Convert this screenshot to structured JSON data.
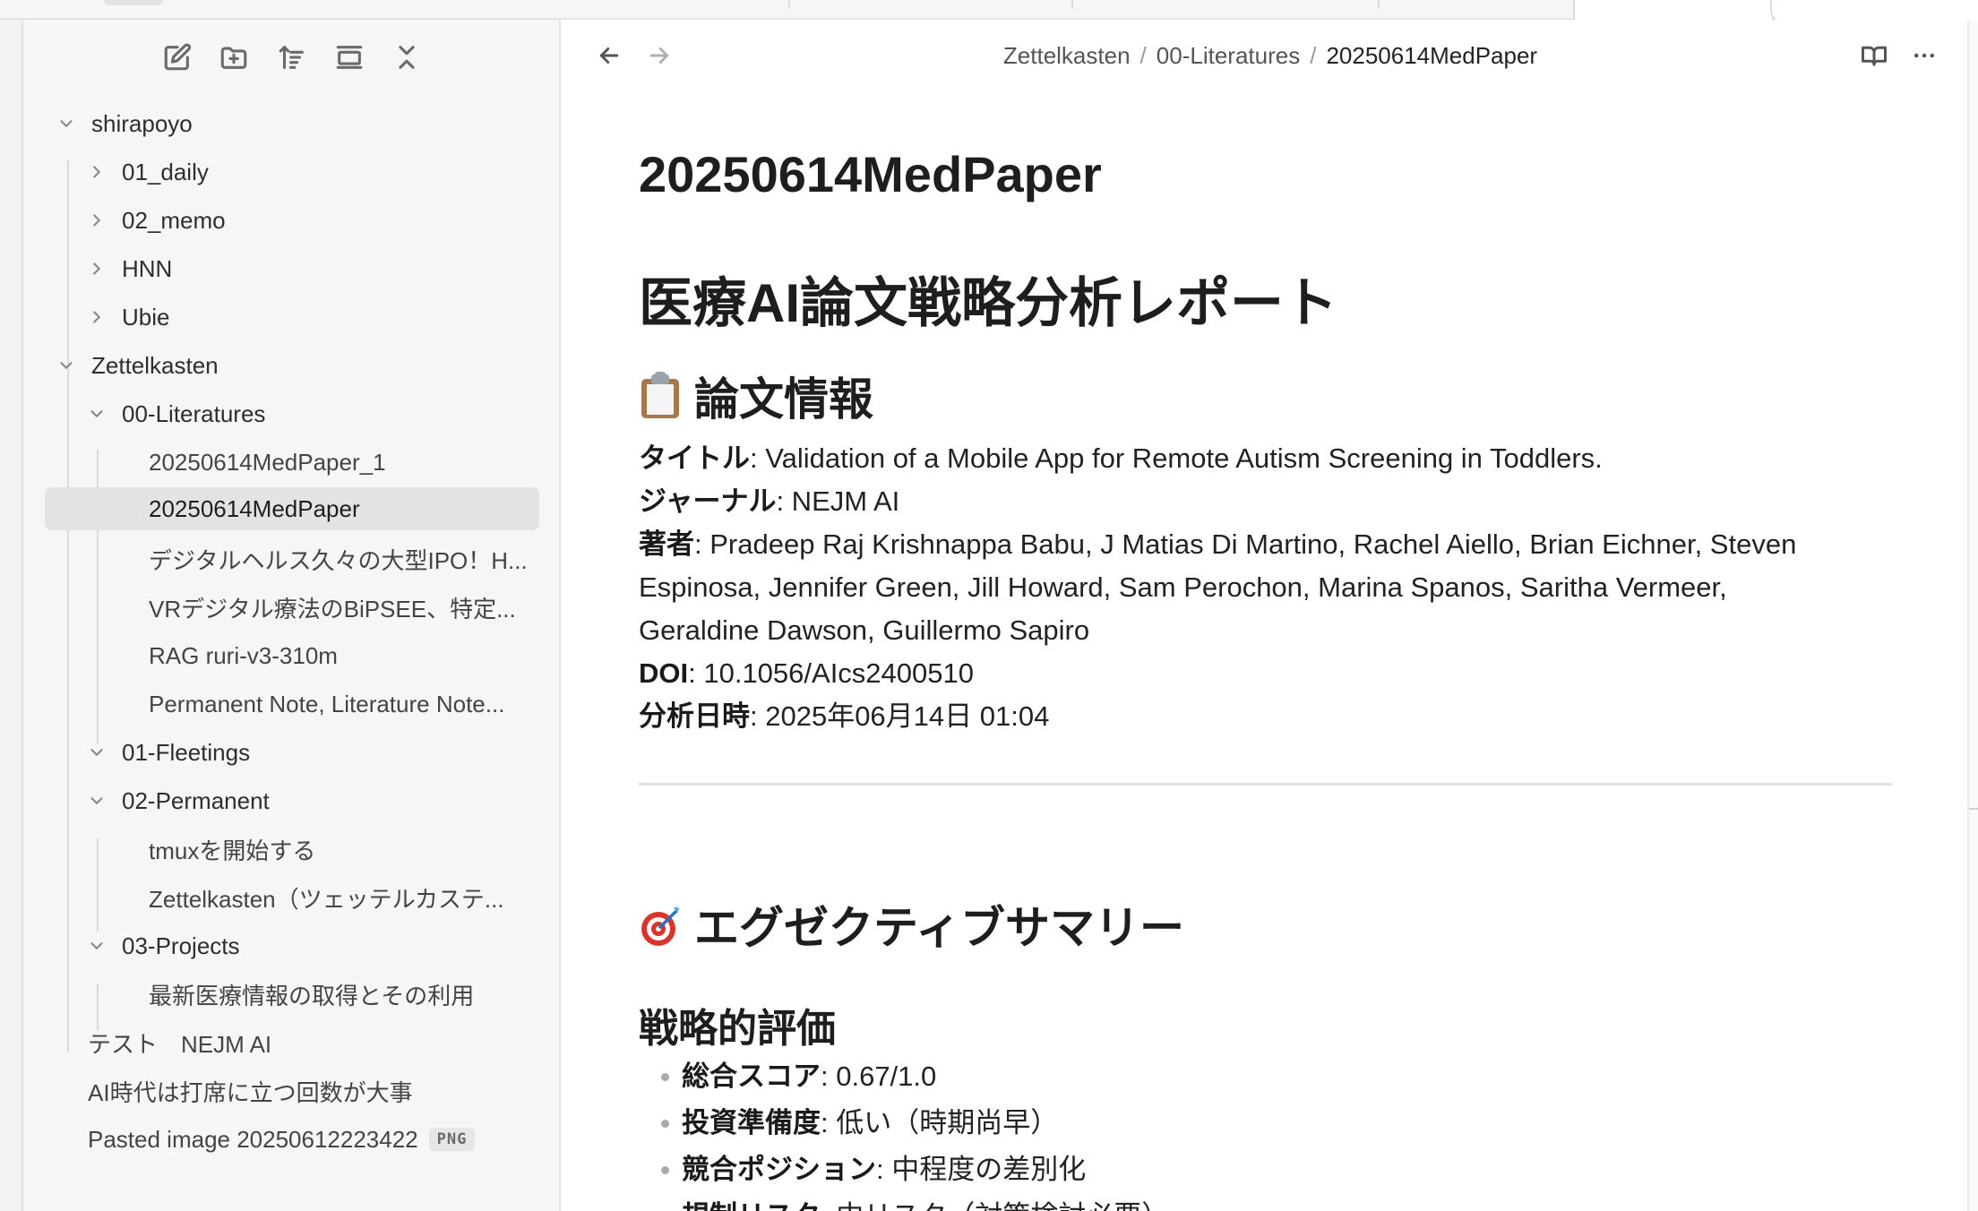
{
  "sidebar": {
    "toolbar": {
      "new_note_icon": "new-note-icon",
      "new_folder_icon": "new-folder-icon",
      "sort_icon": "sort-icon",
      "auto_reveal_icon": "auto-reveal-icon",
      "collapse_all_icon": "collapse-all-icon"
    },
    "tree": {
      "shirapoyo": "shirapoyo",
      "daily": "01_daily",
      "memo": "02_memo",
      "hnn": "HNN",
      "ubie": "Ubie",
      "zettelkasten": "Zettelkasten",
      "literatures": "00-Literatures",
      "medpaper_1": "20250614MedPaper_1",
      "medpaper": "20250614MedPaper",
      "digital_health": "デジタルヘルス久々の大型IPO！H...",
      "vr_digital": "VRデジタル療法のBiPSEE、特定...",
      "rag": "RAG ruri-v3-310m",
      "permanent_note": "Permanent Note, Literature Note...",
      "fleetings": "01-Fleetings",
      "permanent": "02-Permanent",
      "tmux": "tmuxを開始する",
      "zettel_note": "Zettelkasten（ツェッテルカステ...",
      "projects": "03-Projects",
      "latest_medical": "最新医療情報の取得とその利用",
      "test_nejm": "テスト　NEJM AI",
      "ai_era": "AI時代は打席に立つ回数が大事",
      "pasted_image": "Pasted image 20250612223422",
      "png_badge": "PNG"
    }
  },
  "header": {
    "back_icon": "arrow-left-icon",
    "forward_icon": "arrow-right-icon",
    "breadcrumb": [
      "Zettelkasten",
      "00-Literatures",
      "20250614MedPaper"
    ],
    "breadcrumb_sep": "/",
    "reading_view_icon": "book-open-icon",
    "more_icon": "more-options-icon"
  },
  "doc": {
    "title": "20250614MedPaper",
    "h1": "医療AI論文戦略分析レポート",
    "section_paper": "論文情報",
    "paper": {
      "title_label": "タイトル",
      "title_value": ": Validation of a Mobile App for Remote Autism Screening in Toddlers.",
      "journal_label": "ジャーナル",
      "journal_value": ": NEJM AI",
      "authors_label": "著者",
      "authors_line1": ": Pradeep Raj Krishnappa Babu, J Matias Di Martino, Rachel Aiello, Brian Eichner, Steven",
      "authors_line2": "Espinosa, Jennifer Green, Jill Howard, Sam Perochon, Marina Spanos, Saritha Vermeer,",
      "authors_line3": "Geraldine Dawson, Guillermo Sapiro",
      "doi_label": "DOI",
      "doi_value": ": 10.1056/AIcs2400510",
      "date_label": "分析日時",
      "date_value": ": 2025年06月14日 01:04"
    },
    "section_summary": "エグゼクティブサマリー",
    "h3_strategy": "戦略的評価",
    "bullets": [
      {
        "label": "総合スコア",
        "value": ": 0.67/1.0"
      },
      {
        "label": "投資準備度",
        "value": ": 低い（時期尚早）"
      },
      {
        "label": "競合ポジション",
        "value": ": 中程度の差別化"
      },
      {
        "label": "規制リスク",
        "value": ": 中リスク（対策検討必要）"
      }
    ]
  },
  "colors": {
    "sidebar_bg": "#f6f6f6",
    "active_row": "#e3e3e3",
    "text": "#222222",
    "muted": "#8a8a8a"
  }
}
